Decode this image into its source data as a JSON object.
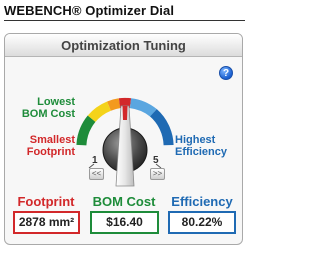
{
  "app": {
    "title": "WEBENCH® Optimizer Dial"
  },
  "panel": {
    "title": "Optimization Tuning",
    "help_label": "?"
  },
  "dial": {
    "labels": {
      "bom": "Lowest BOM Cost",
      "bom_line1": "Lowest",
      "bom_line2": "BOM Cost",
      "footprint_line1": "Smallest",
      "footprint_line2": "Footprint",
      "efficiency_line1": "Highest",
      "efficiency_line2": "Efficiency"
    },
    "scale_min": "1",
    "scale_max": "5",
    "setting": 3,
    "left_button": "<<",
    "right_button": ">>",
    "icons": [
      "dial-knob-icon",
      "help-icon",
      "double-left-arrow-icon",
      "double-right-arrow-icon"
    ]
  },
  "metrics": {
    "footprint": {
      "label": "Footprint",
      "value": "2878 mm²"
    },
    "bom": {
      "label": "BOM Cost",
      "value": "$16.40"
    },
    "efficiency": {
      "label": "Efficiency",
      "value": "80.22%"
    }
  },
  "colors": {
    "footprint": "#d2282a",
    "bom": "#1e8c3a",
    "efficiency": "#1f6ab3",
    "orange": "#f39a1e",
    "yellow": "#f4d31a"
  }
}
